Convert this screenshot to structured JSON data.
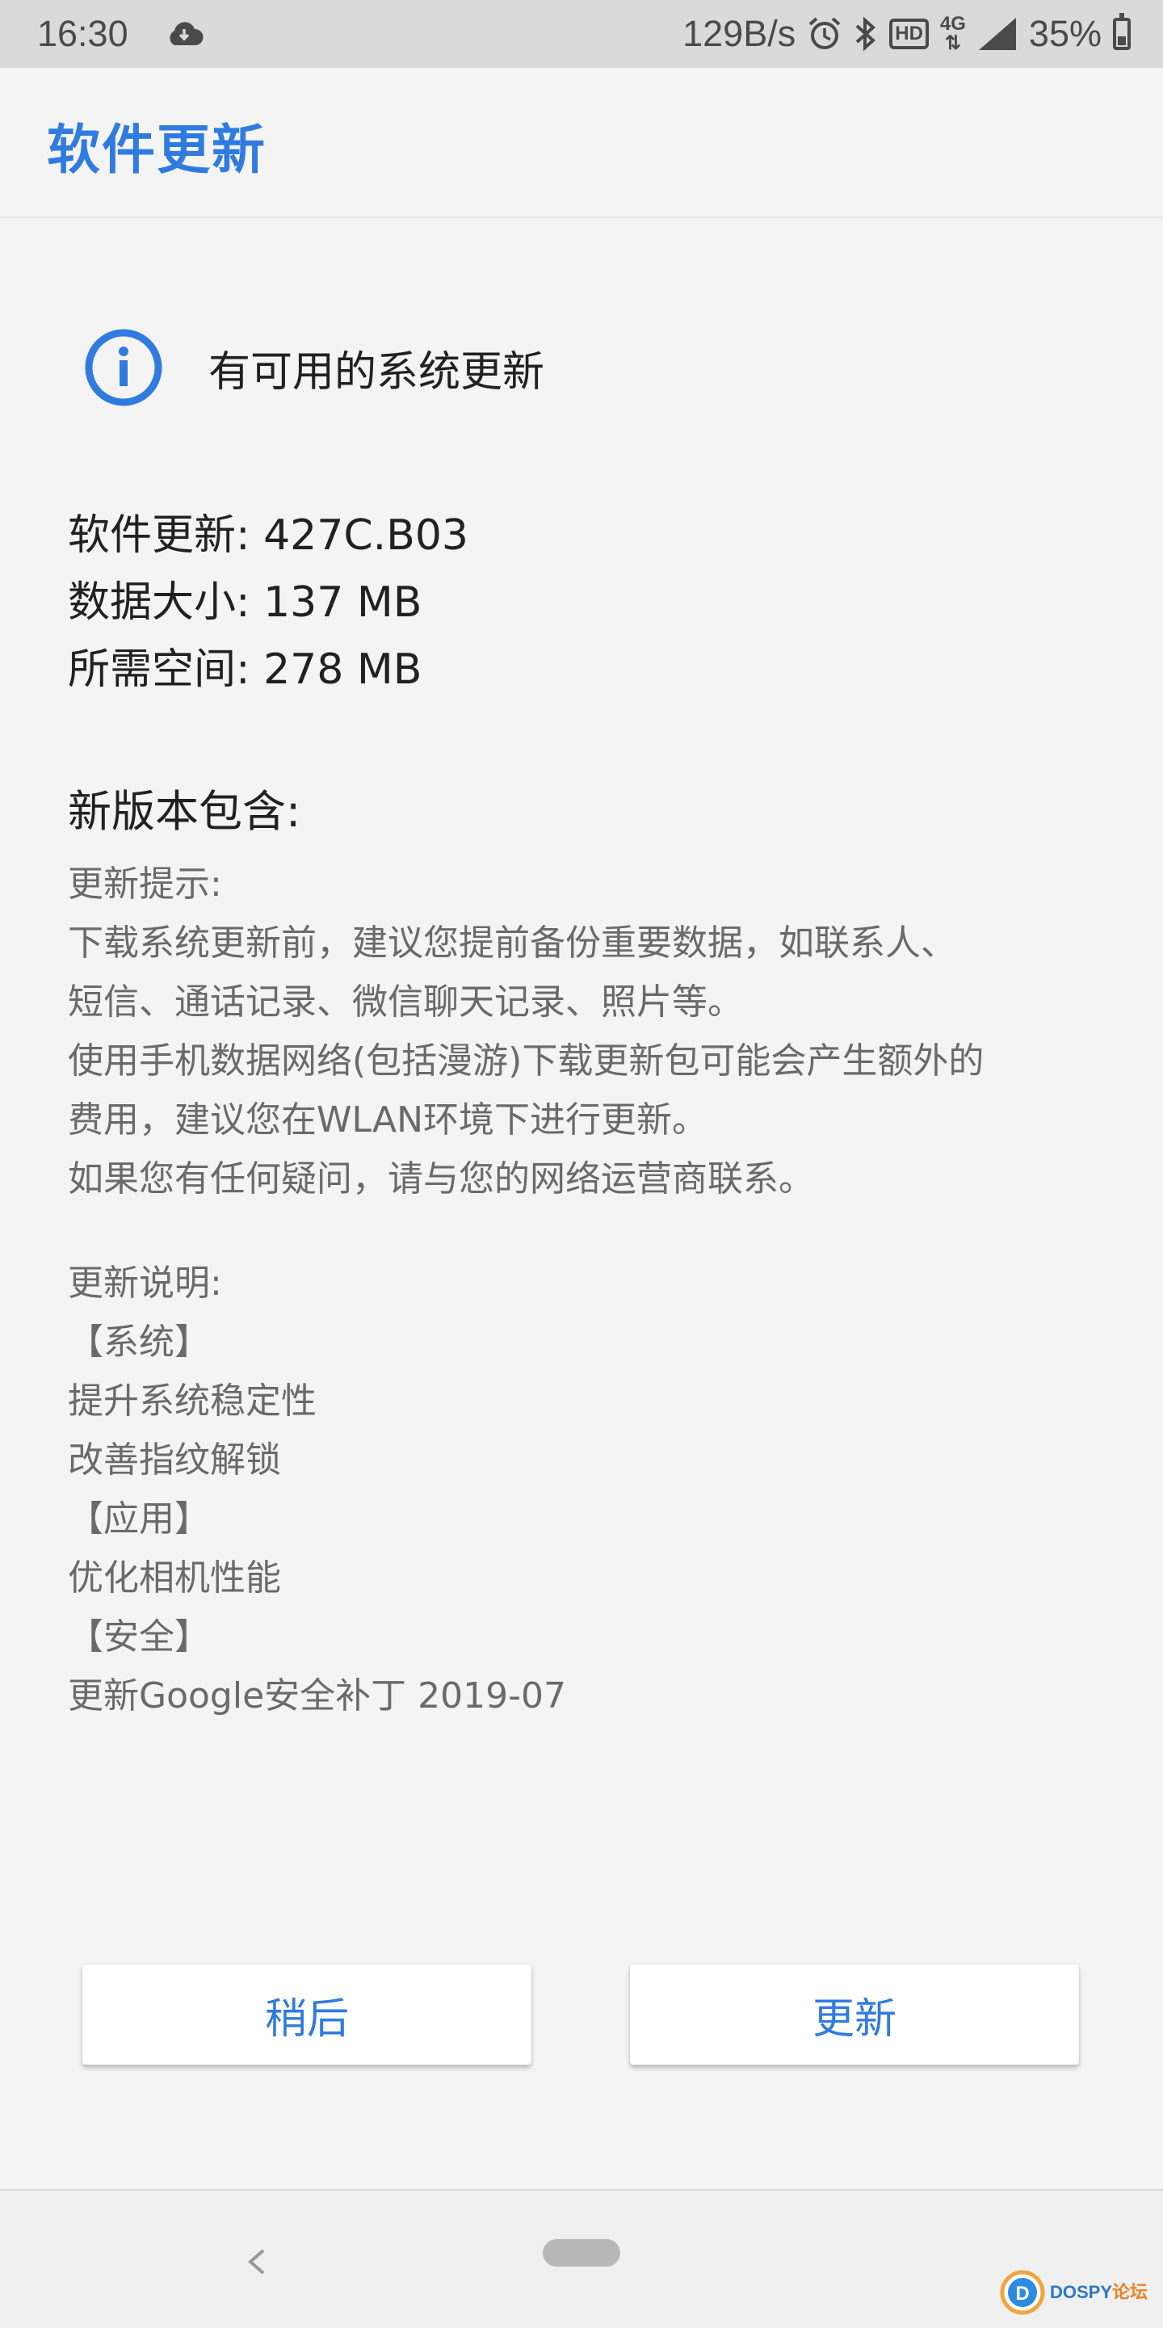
{
  "status_bar": {
    "time": "16:30",
    "net_speed": "129B/s",
    "hd": "HD",
    "network": "4G",
    "battery": "35%",
    "icons": [
      "cloud-icon",
      "alarm-icon",
      "bluetooth-icon",
      "hd-icon",
      "4g-icon",
      "signal-icon",
      "battery-icon"
    ]
  },
  "header": {
    "title": "软件更新"
  },
  "notice": {
    "icon": "info-icon",
    "text": "有可用的系统更新"
  },
  "update_info": {
    "version_label": "软件更新:",
    "version_value": "427C.B03",
    "size_label": "数据大小:",
    "size_value": "137 MB",
    "space_label": "所需空间:",
    "space_value": "278 MB"
  },
  "contents_heading": "新版本包含:",
  "tips": {
    "title": "更新提示:",
    "lines": [
      "下载系统更新前，建议您提前备份重要数据，如联系人、",
      "短信、通话记录、微信聊天记录、照片等。",
      "使用手机数据网络(包括漫游)下载更新包可能会产生额外的",
      "费用，建议您在WLAN环境下进行更新。",
      "如果您有任何疑问，请与您的网络运营商联系。"
    ]
  },
  "release_notes": {
    "title": "更新说明:",
    "lines": [
      "【系统】",
      "提升系统稳定性",
      "改善指纹解锁",
      "【应用】",
      "优化相机性能",
      "【安全】",
      "更新Google安全补丁 2019-07"
    ]
  },
  "buttons": {
    "later": "稍后",
    "update": "更新"
  },
  "navigation": {
    "back_icon": "back-icon",
    "home_icon": "home-pill-icon"
  },
  "watermark": {
    "brand": "DOSPY",
    "brand_suffix": "论坛"
  },
  "colors": {
    "accent": "#2f7be0",
    "status_bar": "#dadada",
    "background": "#f4f4f4"
  },
  "battery_level": 0.35
}
